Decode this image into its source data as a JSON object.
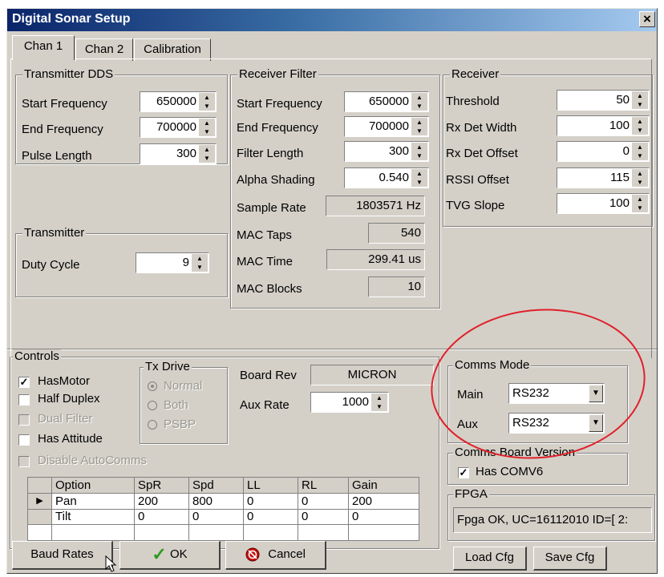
{
  "window": {
    "title": "Digital Sonar Setup",
    "close_label": "×"
  },
  "tabs": [
    {
      "label": "Chan 1"
    },
    {
      "label": "Chan 2"
    },
    {
      "label": "Calibration"
    }
  ],
  "transmitter_dds": {
    "title": "Transmitter DDS",
    "fields": [
      {
        "label": "Start Frequency",
        "value": "650000"
      },
      {
        "label": "End Frequency",
        "value": "700000"
      },
      {
        "label": "Pulse Length",
        "value": "300"
      }
    ]
  },
  "transmitter": {
    "title": "Transmitter",
    "duty_cycle_label": "Duty Cycle",
    "duty_cycle_value": "9"
  },
  "receiver_filter": {
    "title": "Receiver Filter",
    "fields": [
      {
        "label": "Start Frequency",
        "value": "650000"
      },
      {
        "label": "End Frequency",
        "value": "700000"
      },
      {
        "label": "Filter Length",
        "value": "300"
      },
      {
        "label": "Alpha Shading",
        "value": "0.540"
      }
    ],
    "readouts": [
      {
        "label": "Sample Rate",
        "value": "1803571 Hz"
      },
      {
        "label": "MAC Taps",
        "value": "540"
      },
      {
        "label": "MAC Time",
        "value": "299.41 us"
      },
      {
        "label": "MAC Blocks",
        "value": "10"
      }
    ]
  },
  "receiver": {
    "title": "Receiver",
    "fields": [
      {
        "label": "Threshold",
        "value": "50"
      },
      {
        "label": "Rx Det Width",
        "value": "100"
      },
      {
        "label": "Rx Det Offset",
        "value": "0"
      },
      {
        "label": "RSSI Offset",
        "value": "115"
      },
      {
        "label": "TVG Slope",
        "value": "100"
      }
    ]
  },
  "controls": {
    "title": "Controls",
    "checkboxes": [
      {
        "label": "HasMotor",
        "checked": true,
        "enabled": true,
        "mark": "✓"
      },
      {
        "label": "Half Duplex",
        "checked": false,
        "enabled": true,
        "mark": ""
      },
      {
        "label": "Dual Filter",
        "checked": false,
        "enabled": false,
        "mark": ""
      },
      {
        "label": "Has Attitude",
        "checked": false,
        "enabled": true,
        "mark": ""
      },
      {
        "label": "Disable AutoComms",
        "checked": false,
        "enabled": false,
        "mark": ""
      }
    ],
    "tx_drive": {
      "title": "Tx Drive",
      "options": [
        "Normal",
        "Both",
        "PSBP"
      ],
      "selected": "Normal"
    },
    "board_rev_label": "Board Rev",
    "board_rev_value": "MICRON",
    "aux_rate_label": "Aux Rate",
    "aux_rate_value": "1000",
    "table": {
      "headers": [
        "Option",
        "SpR",
        "Spd",
        "LL",
        "RL",
        "Gain"
      ],
      "rows": [
        {
          "indicator": "▶",
          "cells": [
            "Pan",
            "200",
            "800",
            "0",
            "0",
            "200"
          ]
        },
        {
          "indicator": "",
          "cells": [
            "Tilt",
            "0",
            "0",
            "0",
            "0",
            "0"
          ]
        }
      ]
    }
  },
  "comms_mode": {
    "title": "Comms Mode",
    "main_label": "Main",
    "main_value": "RS232",
    "aux_label": "Aux",
    "aux_value": "RS232"
  },
  "comms_board_version": {
    "title": "Comms Board Version",
    "checkbox_label": "Has COMV6",
    "checked": true,
    "mark": "✓"
  },
  "fpga": {
    "title": "FPGA",
    "status": "Fpga OK, UC=16112010 ID=[ 2:"
  },
  "buttons": {
    "baud_rates": "Baud Rates",
    "ok": "OK",
    "cancel": "Cancel",
    "load_cfg": "Load Cfg",
    "save_cfg": "Save Cfg"
  },
  "colors": {
    "dialog_bg": "#d4d0c8",
    "title_bar_start": "#0a246a",
    "title_bar_end": "#a6caf0",
    "annotation_circle": "#e0202a",
    "ok_check": "#2e9a1e",
    "cancel_icon": "#c81010"
  }
}
